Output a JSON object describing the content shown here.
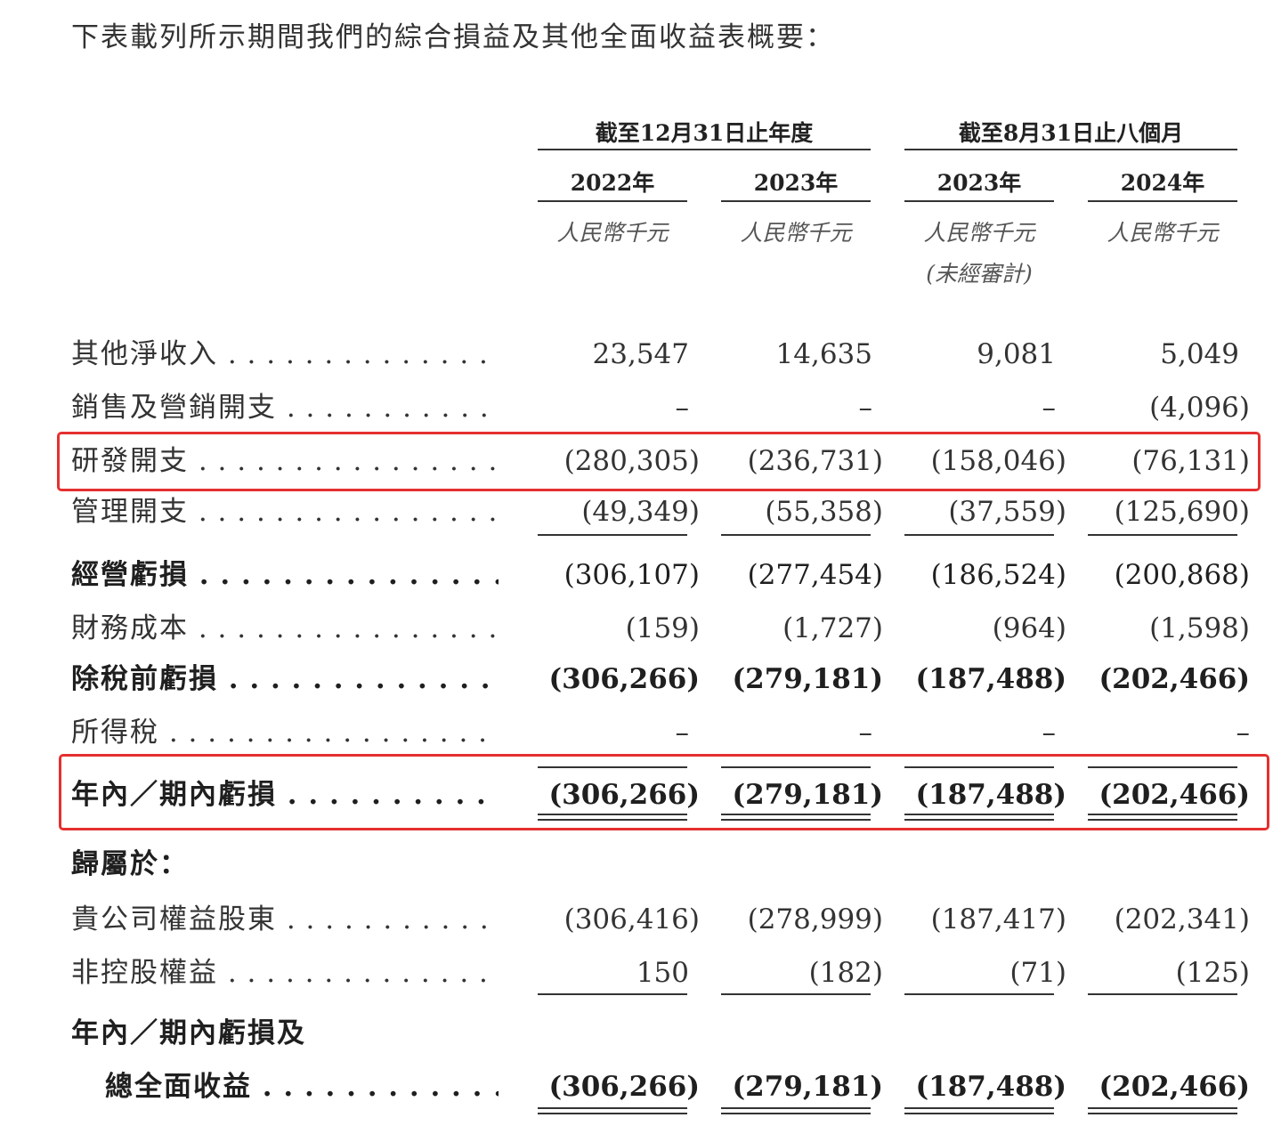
{
  "intro": "下表載列所示期間我們的綜合損益及其他全面收益表概要：",
  "headers": {
    "group_year": "截至12月31日止年度",
    "group_eight_months": "截至8月31日止八個月",
    "years": [
      "2022年",
      "2023年",
      "2023年",
      "2024年"
    ],
    "unit": "人民幣千元",
    "unaudited": "(未經審計)"
  },
  "rows": {
    "other_income": {
      "label": "其他淨收入",
      "values": [
        "23,547",
        "14,635",
        "9,081",
        "5,049"
      ]
    },
    "selling": {
      "label": "銷售及營銷開支",
      "values": [
        "–",
        "–",
        "–",
        "(4,096)"
      ]
    },
    "rnd": {
      "label": "研發開支",
      "values": [
        "(280,305)",
        "(236,731)",
        "(158,046)",
        "(76,131)"
      ]
    },
    "admin": {
      "label": "管理開支",
      "values": [
        "(49,349)",
        "(55,358)",
        "(37,559)",
        "(125,690)"
      ]
    },
    "op_loss": {
      "label": "經營虧損",
      "values": [
        "(306,107)",
        "(277,454)",
        "(186,524)",
        "(200,868)"
      ]
    },
    "finance": {
      "label": "財務成本",
      "values": [
        "(159)",
        "(1,727)",
        "(964)",
        "(1,598)"
      ]
    },
    "pretax": {
      "label": "除稅前虧損",
      "values": [
        "(306,266)",
        "(279,181)",
        "(187,488)",
        "(202,466)"
      ]
    },
    "tax": {
      "label": "所得稅",
      "values": [
        "–",
        "–",
        "–",
        "–"
      ]
    },
    "period_loss": {
      "label": "年內／期內虧損",
      "values": [
        "(306,266)",
        "(279,181)",
        "(187,488)",
        "(202,466)"
      ]
    },
    "attributable": {
      "label": "歸屬於："
    },
    "equity_holders": {
      "label": "貴公司權益股東",
      "values": [
        "(306,416)",
        "(278,999)",
        "(187,417)",
        "(202,341)"
      ]
    },
    "nci": {
      "label": "非控股權益",
      "values": [
        "150",
        "(182)",
        "(71)",
        "(125)"
      ]
    },
    "total_label_1": {
      "label": "年內／期內虧損及"
    },
    "total": {
      "label": "總全面收益",
      "values": [
        "(306,266)",
        "(279,181)",
        "(187,488)",
        "(202,466)"
      ]
    }
  },
  "highlight_color": "#e53030"
}
